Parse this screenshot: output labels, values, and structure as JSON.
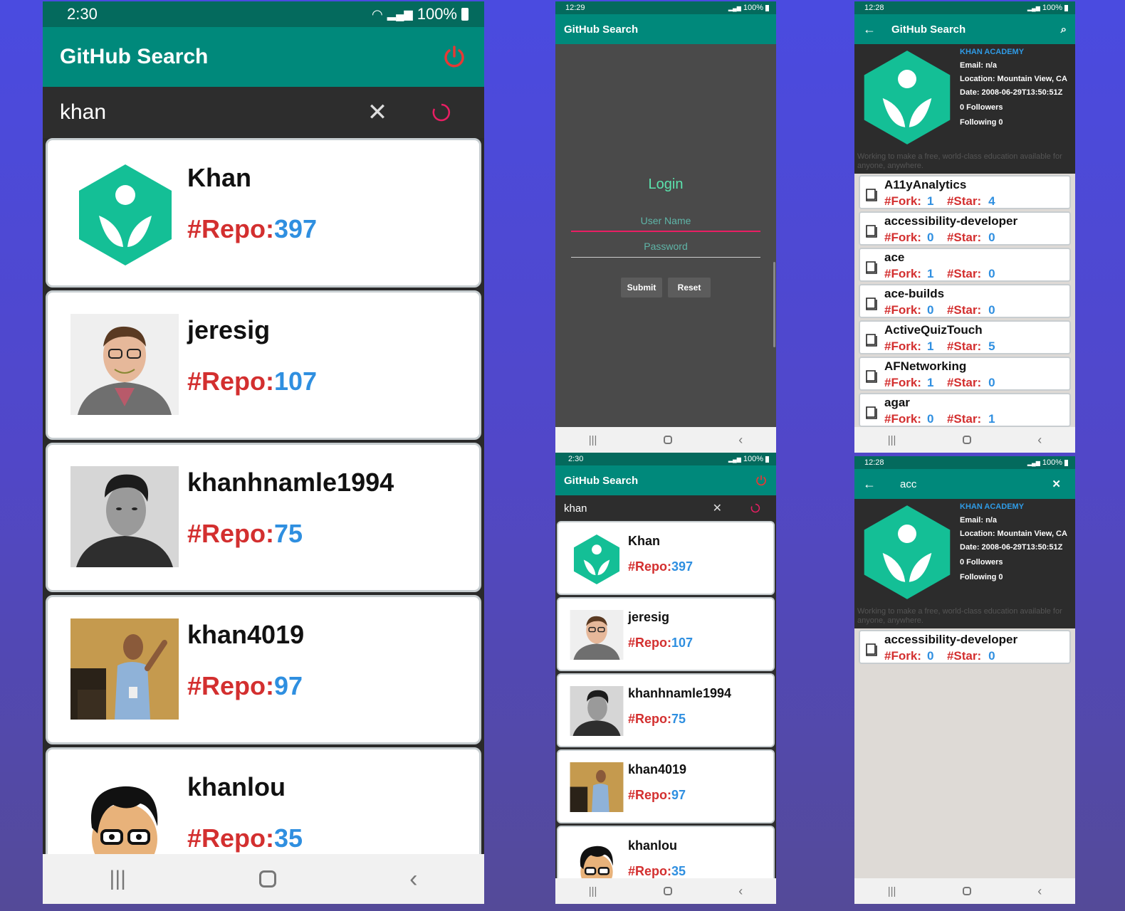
{
  "phone_a": {
    "status": {
      "time": "2:30",
      "battery": "100%"
    },
    "app_title": "GitHub Search",
    "search_value": "khan",
    "users": [
      {
        "name": "Khan",
        "repo_label": "#Repo:",
        "repo_count": "397"
      },
      {
        "name": "jeresig",
        "repo_label": "#Repo:",
        "repo_count": "107"
      },
      {
        "name": "khanhnamle1994",
        "repo_label": "#Repo:",
        "repo_count": "75"
      },
      {
        "name": "khan4019",
        "repo_label": "#Repo:",
        "repo_count": "97"
      },
      {
        "name": "khanlou",
        "repo_label": "#Repo:",
        "repo_count": "35"
      }
    ]
  },
  "phone_b": {
    "status": {
      "time": "12:29",
      "battery": "100%"
    },
    "app_title": "GitHub Search",
    "login_title": "Login",
    "username_placeholder": "User Name",
    "password_placeholder": "Password",
    "submit_label": "Submit",
    "reset_label": "Reset"
  },
  "phone_c": {
    "status": {
      "time": "2:30",
      "battery": "100%"
    },
    "app_title": "GitHub Search",
    "search_value": "khan",
    "users": [
      {
        "name": "Khan",
        "repo_label": "#Repo:",
        "repo_count": "397"
      },
      {
        "name": "jeresig",
        "repo_label": "#Repo:",
        "repo_count": "107"
      },
      {
        "name": "khanhnamle1994",
        "repo_label": "#Repo:",
        "repo_count": "75"
      },
      {
        "name": "khan4019",
        "repo_label": "#Repo:",
        "repo_count": "97"
      },
      {
        "name": "khanlou",
        "repo_label": "#Repo:",
        "repo_count": "35"
      }
    ]
  },
  "phone_d": {
    "status": {
      "time": "12:28",
      "battery": "100%"
    },
    "app_title": "GitHub Search",
    "profile": {
      "org": "KHAN ACADEMY",
      "email": "Email: n/a",
      "location": "Location: Mountain View, CA",
      "date": "Date: 2008-06-29T13:50:51Z",
      "followers": "0  Followers",
      "following": "Following 0",
      "description": "Working to make a free, world-class education available for anyone, anywhere."
    },
    "fork_label": "#Fork:",
    "star_label": "#Star:",
    "repos": [
      {
        "name": "A11yAnalytics",
        "fork": "1",
        "star": "4"
      },
      {
        "name": "accessibility-developer",
        "fork": "0",
        "star": "0"
      },
      {
        "name": "ace",
        "fork": "1",
        "star": "0"
      },
      {
        "name": "ace-builds",
        "fork": "0",
        "star": "0"
      },
      {
        "name": "ActiveQuizTouch",
        "fork": "1",
        "star": "5"
      },
      {
        "name": "AFNetworking",
        "fork": "1",
        "star": "0"
      },
      {
        "name": "agar",
        "fork": "0",
        "star": "1"
      }
    ]
  },
  "phone_e": {
    "status": {
      "time": "12:28",
      "battery": "100%"
    },
    "search_value": "acc",
    "profile": {
      "org": "KHAN ACADEMY",
      "email": "Email: n/a",
      "location": "Location: Mountain View, CA",
      "date": "Date: 2008-06-29T13:50:51Z",
      "followers": "0  Followers",
      "following": "Following 0",
      "description": "Working to make a free, world-class education available for anyone, anywhere."
    },
    "fork_label": "#Fork:",
    "star_label": "#Star:",
    "repos": [
      {
        "name": "accessibility-developer",
        "fork": "0",
        "star": "0"
      }
    ]
  },
  "colors": {
    "teal": "#00897b",
    "dark_teal": "#046a5d",
    "khan_green": "#14bf96",
    "repo_red": "#d32f2f",
    "repo_blue": "#2f8fe0",
    "power_red": "#e53935"
  }
}
